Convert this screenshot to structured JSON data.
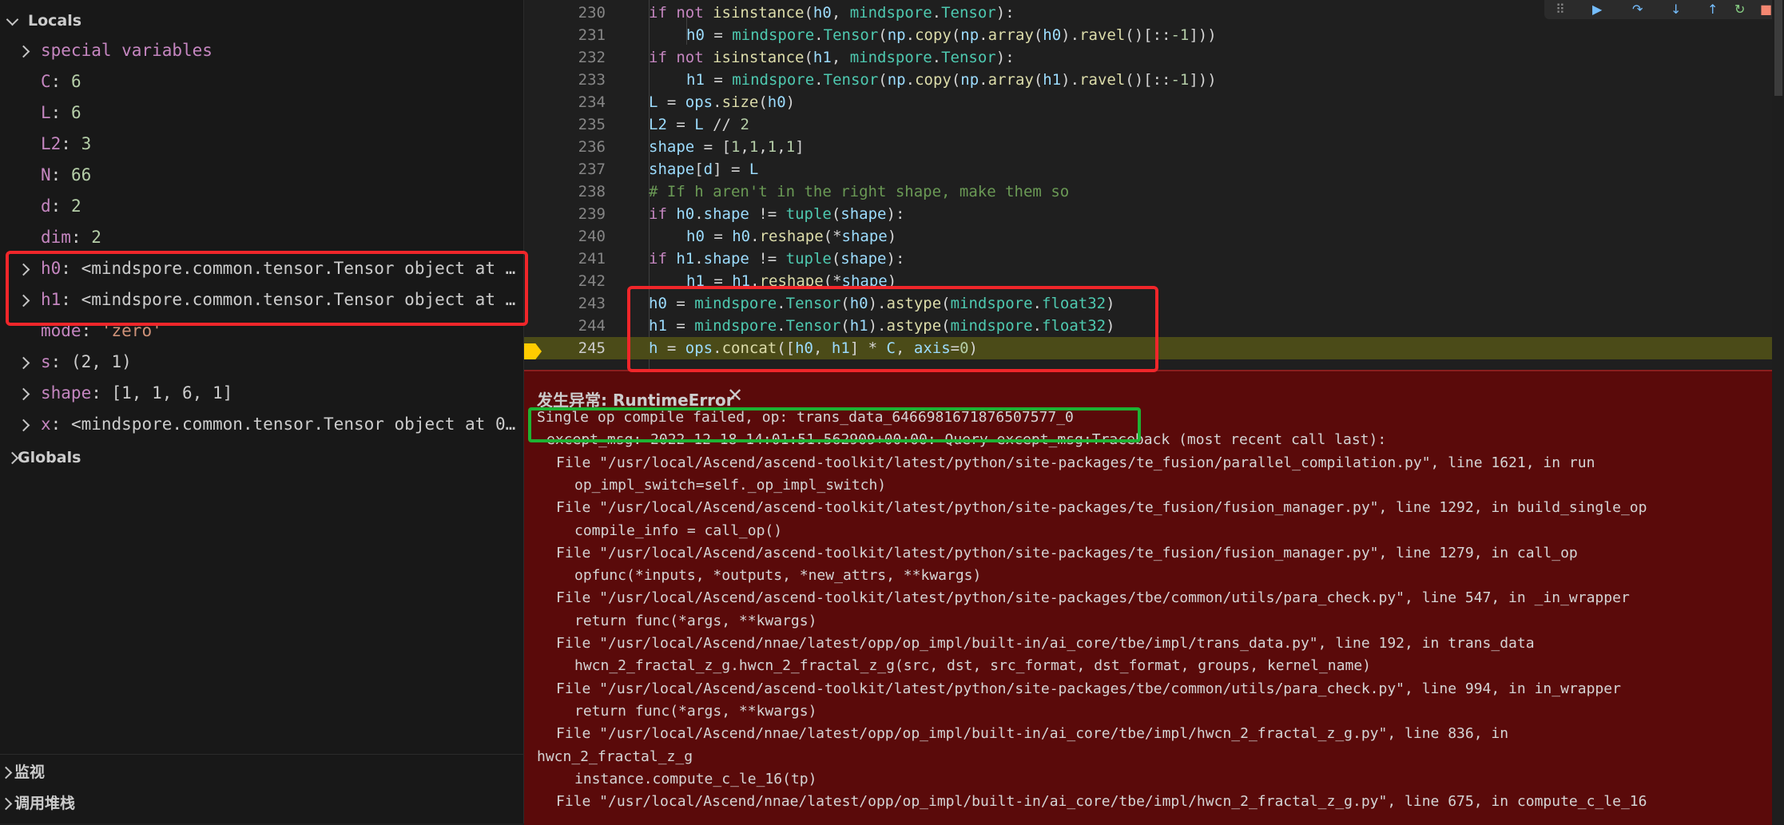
{
  "variables_panel": {
    "locals_header": "Locals",
    "locals": [
      {
        "type": "expand",
        "name": "special variables",
        "value": ""
      },
      {
        "type": "leaf",
        "name": "C",
        "value": "6",
        "kind": "num"
      },
      {
        "type": "leaf",
        "name": "L",
        "value": "6",
        "kind": "num"
      },
      {
        "type": "leaf",
        "name": "L2",
        "value": "3",
        "kind": "num"
      },
      {
        "type": "leaf",
        "name": "N",
        "value": "66",
        "kind": "num"
      },
      {
        "type": "leaf",
        "name": "d",
        "value": "2",
        "kind": "num"
      },
      {
        "type": "leaf",
        "name": "dim",
        "value": "2",
        "kind": "num"
      },
      {
        "type": "expand",
        "name": "h0",
        "value": "<mindspore.common.tensor.Tensor object at …",
        "kind": "obj"
      },
      {
        "type": "expand",
        "name": "h1",
        "value": "<mindspore.common.tensor.Tensor object at …",
        "kind": "obj"
      },
      {
        "type": "leaf",
        "name": "mode",
        "value": "'zero'",
        "kind": "str"
      },
      {
        "type": "expand",
        "name": "s",
        "value": "(2, 1)",
        "kind": "obj"
      },
      {
        "type": "expand",
        "name": "shape",
        "value": "[1, 1, 6, 1]",
        "kind": "obj"
      },
      {
        "type": "expand",
        "name": "x",
        "value": "<mindspore.common.tensor.Tensor object at 0…",
        "kind": "obj"
      }
    ],
    "globals_header": "Globals",
    "watch_header": "监视",
    "callstack_header": "调用堆栈"
  },
  "editor": {
    "current_line": "245",
    "lines": [
      {
        "no": "230",
        "indent": 1,
        "tokens": [
          [
            "kw",
            "if not "
          ],
          [
            "fn",
            "isinstance"
          ],
          [
            "op",
            "("
          ],
          [
            "var",
            "h0"
          ],
          [
            "op",
            ", "
          ],
          [
            "mod",
            "mindspore"
          ],
          [
            "op",
            "."
          ],
          [
            "mod",
            "Tensor"
          ],
          [
            "op",
            "):"
          ]
        ]
      },
      {
        "no": "231",
        "indent": 2,
        "tokens": [
          [
            "var",
            "h0"
          ],
          [
            "op",
            " = "
          ],
          [
            "mod",
            "mindspore"
          ],
          [
            "op",
            "."
          ],
          [
            "mod",
            "Tensor"
          ],
          [
            "op",
            "("
          ],
          [
            "var",
            "np"
          ],
          [
            "op",
            "."
          ],
          [
            "fn",
            "copy"
          ],
          [
            "op",
            "("
          ],
          [
            "var",
            "np"
          ],
          [
            "op",
            "."
          ],
          [
            "fn",
            "array"
          ],
          [
            "op",
            "("
          ],
          [
            "var",
            "h0"
          ],
          [
            "op",
            ")."
          ],
          [
            "fn",
            "ravel"
          ],
          [
            "op",
            "()[::"
          ],
          [
            "num",
            "-1"
          ],
          [
            "op",
            "]))"
          ]
        ]
      },
      {
        "no": "232",
        "indent": 1,
        "tokens": [
          [
            "kw",
            "if not "
          ],
          [
            "fn",
            "isinstance"
          ],
          [
            "op",
            "("
          ],
          [
            "var",
            "h1"
          ],
          [
            "op",
            ", "
          ],
          [
            "mod",
            "mindspore"
          ],
          [
            "op",
            "."
          ],
          [
            "mod",
            "Tensor"
          ],
          [
            "op",
            "):"
          ]
        ]
      },
      {
        "no": "233",
        "indent": 2,
        "tokens": [
          [
            "var",
            "h1"
          ],
          [
            "op",
            " = "
          ],
          [
            "mod",
            "mindspore"
          ],
          [
            "op",
            "."
          ],
          [
            "mod",
            "Tensor"
          ],
          [
            "op",
            "("
          ],
          [
            "var",
            "np"
          ],
          [
            "op",
            "."
          ],
          [
            "fn",
            "copy"
          ],
          [
            "op",
            "("
          ],
          [
            "var",
            "np"
          ],
          [
            "op",
            "."
          ],
          [
            "fn",
            "array"
          ],
          [
            "op",
            "("
          ],
          [
            "var",
            "h1"
          ],
          [
            "op",
            ")."
          ],
          [
            "fn",
            "ravel"
          ],
          [
            "op",
            "()[::"
          ],
          [
            "num",
            "-1"
          ],
          [
            "op",
            "]))"
          ]
        ]
      },
      {
        "no": "234",
        "indent": 1,
        "tokens": [
          [
            "var",
            "L"
          ],
          [
            "op",
            " = "
          ],
          [
            "var",
            "ops"
          ],
          [
            "op",
            "."
          ],
          [
            "fn",
            "size"
          ],
          [
            "op",
            "("
          ],
          [
            "var",
            "h0"
          ],
          [
            "op",
            ")"
          ]
        ]
      },
      {
        "no": "235",
        "indent": 1,
        "tokens": [
          [
            "var",
            "L2"
          ],
          [
            "op",
            " = "
          ],
          [
            "var",
            "L"
          ],
          [
            "op",
            " // "
          ],
          [
            "num",
            "2"
          ]
        ]
      },
      {
        "no": "236",
        "indent": 1,
        "tokens": [
          [
            "var",
            "shape"
          ],
          [
            "op",
            " = ["
          ],
          [
            "num",
            "1"
          ],
          [
            "op",
            ","
          ],
          [
            "num",
            "1"
          ],
          [
            "op",
            ","
          ],
          [
            "num",
            "1"
          ],
          [
            "op",
            ","
          ],
          [
            "num",
            "1"
          ],
          [
            "op",
            "]"
          ]
        ]
      },
      {
        "no": "237",
        "indent": 1,
        "tokens": [
          [
            "var",
            "shape"
          ],
          [
            "op",
            "["
          ],
          [
            "var",
            "d"
          ],
          [
            "op",
            "] = "
          ],
          [
            "var",
            "L"
          ]
        ]
      },
      {
        "no": "238",
        "indent": 1,
        "tokens": [
          [
            "cmt",
            "# If h aren't in the right shape, make them so"
          ]
        ]
      },
      {
        "no": "239",
        "indent": 1,
        "tokens": [
          [
            "kw",
            "if "
          ],
          [
            "var",
            "h0"
          ],
          [
            "op",
            "."
          ],
          [
            "var",
            "shape"
          ],
          [
            "op",
            " != "
          ],
          [
            "mod",
            "tuple"
          ],
          [
            "op",
            "("
          ],
          [
            "var",
            "shape"
          ],
          [
            "op",
            "):"
          ]
        ]
      },
      {
        "no": "240",
        "indent": 2,
        "tokens": [
          [
            "var",
            "h0"
          ],
          [
            "op",
            " = "
          ],
          [
            "var",
            "h0"
          ],
          [
            "op",
            "."
          ],
          [
            "fn",
            "reshape"
          ],
          [
            "op",
            "(*"
          ],
          [
            "var",
            "shape"
          ],
          [
            "op",
            ")"
          ]
        ]
      },
      {
        "no": "241",
        "indent": 1,
        "tokens": [
          [
            "kw",
            "if "
          ],
          [
            "var",
            "h1"
          ],
          [
            "op",
            "."
          ],
          [
            "var",
            "shape"
          ],
          [
            "op",
            " != "
          ],
          [
            "mod",
            "tuple"
          ],
          [
            "op",
            "("
          ],
          [
            "var",
            "shape"
          ],
          [
            "op",
            "):"
          ]
        ]
      },
      {
        "no": "242",
        "indent": 2,
        "tokens": [
          [
            "var",
            "h1"
          ],
          [
            "op",
            " = "
          ],
          [
            "var",
            "h1"
          ],
          [
            "op",
            "."
          ],
          [
            "fn",
            "reshape"
          ],
          [
            "op",
            "(*"
          ],
          [
            "var",
            "shape"
          ],
          [
            "op",
            ")"
          ]
        ]
      },
      {
        "no": "243",
        "indent": 1,
        "tokens": [
          [
            "var",
            "h0"
          ],
          [
            "op",
            " = "
          ],
          [
            "mod",
            "mindspore"
          ],
          [
            "op",
            "."
          ],
          [
            "mod",
            "Tensor"
          ],
          [
            "op",
            "("
          ],
          [
            "var",
            "h0"
          ],
          [
            "op",
            ")."
          ],
          [
            "fn",
            "astype"
          ],
          [
            "op",
            "("
          ],
          [
            "mod",
            "mindspore"
          ],
          [
            "op",
            "."
          ],
          [
            "mod",
            "float32"
          ],
          [
            "op",
            ")"
          ]
        ]
      },
      {
        "no": "244",
        "indent": 1,
        "tokens": [
          [
            "var",
            "h1"
          ],
          [
            "op",
            " = "
          ],
          [
            "mod",
            "mindspore"
          ],
          [
            "op",
            "."
          ],
          [
            "mod",
            "Tensor"
          ],
          [
            "op",
            "("
          ],
          [
            "var",
            "h1"
          ],
          [
            "op",
            ")."
          ],
          [
            "fn",
            "astype"
          ],
          [
            "op",
            "("
          ],
          [
            "mod",
            "mindspore"
          ],
          [
            "op",
            "."
          ],
          [
            "mod",
            "float32"
          ],
          [
            "op",
            ")"
          ]
        ]
      },
      {
        "no": "245",
        "indent": 1,
        "tokens": [
          [
            "var",
            "h"
          ],
          [
            "op",
            " = "
          ],
          [
            "var",
            "ops"
          ],
          [
            "op",
            "."
          ],
          [
            "fn",
            "concat"
          ],
          [
            "op",
            "(["
          ],
          [
            "var",
            "h0"
          ],
          [
            "op",
            ", "
          ],
          [
            "var",
            "h1"
          ],
          [
            "op",
            "] * "
          ],
          [
            "var",
            "C"
          ],
          [
            "op",
            ", "
          ],
          [
            "var",
            "axis"
          ],
          [
            "op",
            "="
          ],
          [
            "num",
            "0"
          ],
          [
            "op",
            ")"
          ]
        ]
      }
    ]
  },
  "exception": {
    "title": "发生异常: RuntimeError",
    "close_glyph": "✕",
    "lines": [
      {
        "x": 16,
        "text": "Single op compile failed, op: trans_data_6466981671876507577_0"
      },
      {
        "x": 28,
        "text": "except_msg: 2022-12-18 14:01:51.562909+00:00: Query except_msg:Traceback (most recent call last):"
      },
      {
        "x": 40,
        "text": "File \"/usr/local/Ascend/ascend-toolkit/latest/python/site-packages/te_fusion/parallel_compilation.py\", line 1621, in run"
      },
      {
        "x": 63,
        "text": "op_impl_switch=self._op_impl_switch)"
      },
      {
        "x": 40,
        "text": "File \"/usr/local/Ascend/ascend-toolkit/latest/python/site-packages/te_fusion/fusion_manager.py\", line 1292, in build_single_op"
      },
      {
        "x": 63,
        "text": "compile_info = call_op()"
      },
      {
        "x": 40,
        "text": "File \"/usr/local/Ascend/ascend-toolkit/latest/python/site-packages/te_fusion/fusion_manager.py\", line 1279, in call_op"
      },
      {
        "x": 63,
        "text": "opfunc(*inputs, *outputs, *new_attrs, **kwargs)"
      },
      {
        "x": 40,
        "text": "File \"/usr/local/Ascend/ascend-toolkit/latest/python/site-packages/tbe/common/utils/para_check.py\", line 547, in _in_wrapper"
      },
      {
        "x": 63,
        "text": "return func(*args, **kwargs)"
      },
      {
        "x": 40,
        "text": "File \"/usr/local/Ascend/nnae/latest/opp/op_impl/built-in/ai_core/tbe/impl/trans_data.py\", line 192, in trans_data"
      },
      {
        "x": 63,
        "text": "hwcn_2_fractal_z_g.hwcn_2_fractal_z_g(src, dst, src_format, dst_format, groups, kernel_name)"
      },
      {
        "x": 40,
        "text": "File \"/usr/local/Ascend/ascend-toolkit/latest/python/site-packages/tbe/common/utils/para_check.py\", line 994, in in_wrapper"
      },
      {
        "x": 63,
        "text": "return func(*args, **kwargs)"
      },
      {
        "x": 40,
        "text": "File \"/usr/local/Ascend/nnae/latest/opp/op_impl/built-in/ai_core/tbe/impl/hwcn_2_fractal_z_g.py\", line 836, in"
      },
      {
        "x": 16,
        "text": "hwcn_2_fractal_z_g"
      },
      {
        "x": 63,
        "text": "instance.compute_c_le_16(tp)"
      },
      {
        "x": 40,
        "text": "File \"/usr/local/Ascend/nnae/latest/opp/op_impl/built-in/ai_core/tbe/impl/hwcn_2_fractal_z_g.py\", line 675, in compute_c_le_16"
      }
    ]
  },
  "colors": {
    "highlight_red": "#f0262a",
    "highlight_green": "#1db233",
    "exception_bg": "#5a0a0a",
    "current_line_bg": "#4b4b18"
  }
}
